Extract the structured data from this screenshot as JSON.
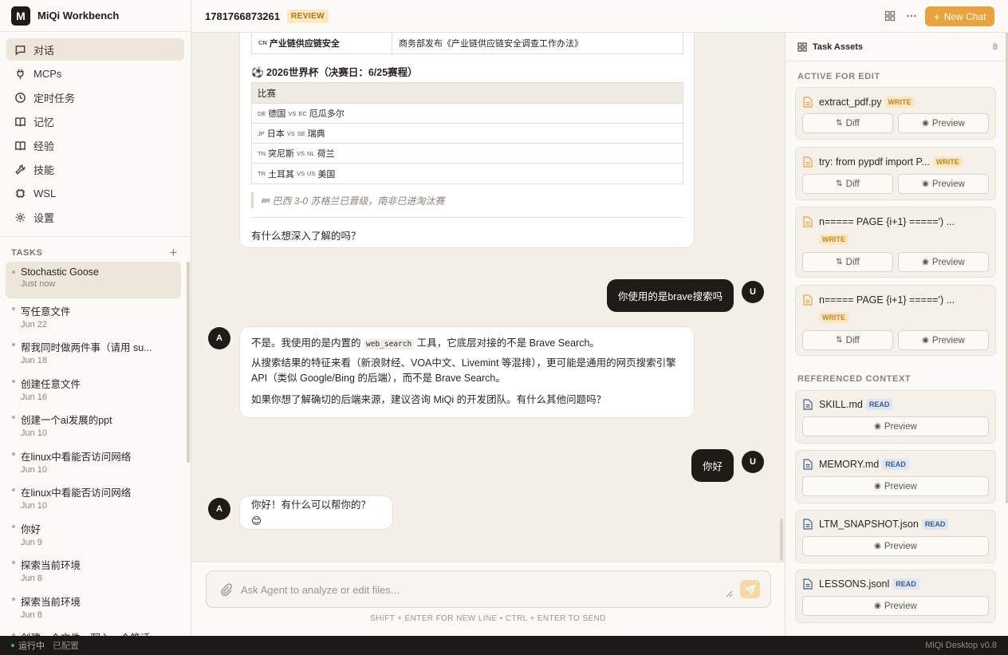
{
  "app": {
    "name": "MiQi Workbench",
    "logo_letter": "M"
  },
  "nav": [
    {
      "label": "对话",
      "icon": "chat-icon",
      "active": true
    },
    {
      "label": "MCPs",
      "icon": "plug-icon"
    },
    {
      "label": "定时任务",
      "icon": "clock-icon"
    },
    {
      "label": "记忆",
      "icon": "book-icon"
    },
    {
      "label": "经验",
      "icon": "book-open-icon"
    },
    {
      "label": "技能",
      "icon": "wrench-icon"
    },
    {
      "label": "WSL",
      "icon": "chip-icon"
    },
    {
      "label": "设置",
      "icon": "gear-icon"
    }
  ],
  "tasks": {
    "heading": "TASKS",
    "add_label": "+",
    "items": [
      {
        "title": "Stochastic Goose",
        "date": "Just now",
        "active": true
      },
      {
        "title": "写任意文件",
        "date": "Jun 22"
      },
      {
        "title": "帮我同时做两件事（请用 su...",
        "date": "Jun 18"
      },
      {
        "title": "创建任意文件",
        "date": "Jun 16"
      },
      {
        "title": "创建一个ai发展的ppt",
        "date": "Jun 10"
      },
      {
        "title": "在linux中看能否访问网络",
        "date": "Jun 10"
      },
      {
        "title": "在linux中看能否访问网络",
        "date": "Jun 10"
      },
      {
        "title": "你好",
        "date": "Jun 9"
      },
      {
        "title": "探索当前环境",
        "date": "Jun 8"
      },
      {
        "title": "探索当前环境",
        "date": "Jun 8"
      },
      {
        "title": "创建一个文件，写入一个笑话",
        "date": ""
      }
    ]
  },
  "header": {
    "chat_id": "1781766873261",
    "status": "REVIEW",
    "new_chat_label": "New Chat"
  },
  "chat": {
    "news_row": {
      "flag": "CN",
      "topic": "产业链供应链安全",
      "detail": "商务部发布《产业链供应链安全调查工作办法》"
    },
    "worldcup_title": "⚽ 2026世界杯（决赛日：6/25赛程）",
    "match_header": "比赛",
    "matches": [
      {
        "f1": "DE",
        "t1": "德国",
        "vs": "VS",
        "f2": "EC",
        "t2": "厄瓜多尔"
      },
      {
        "f1": "JP",
        "t1": "日本",
        "vs": "VS",
        "f2": "SE",
        "t2": "瑞典"
      },
      {
        "f1": "TN",
        "t1": "突尼斯",
        "vs": "VS",
        "f2": "NL",
        "t2": "荷兰"
      },
      {
        "f1": "TR",
        "t1": "土耳其",
        "vs": "VS",
        "f2": "US",
        "t2": "美国"
      }
    ],
    "quote_flag": "BR",
    "quote": "巴西 3-0 苏格兰已晋级，南非已进淘汰赛",
    "follow_up": "有什么想深入了解的吗？",
    "user_avatar": "U",
    "agent_avatar": "A",
    "user_msg_1": "你使用的是brave搜索吗",
    "agent_msg_1_pre": "不是。我使用的是内置的",
    "agent_msg_1_code": "web_search",
    "agent_msg_1_post": "工具，它底层对接的不是 Brave Search。",
    "agent_msg_1_p2": "从搜索结果的特征来看（新浪财经、VOA中文、Livemint 等混排），更可能是通用的网页搜索引擎 API（类似 Google/Bing 的后端），而不是 Brave Search。",
    "agent_msg_1_p3": "如果你想了解确切的后端来源，建议咨询 MiQi 的开发团队。有什么其他问题吗？",
    "user_msg_2": "你好",
    "agent_msg_2": "你好！有什么可以帮你的？ 😊"
  },
  "composer": {
    "placeholder": "Ask Agent to analyze or edit files...",
    "hint": "SHIFT + ENTER FOR NEW LINE • CTRL + ENTER TO SEND"
  },
  "assets": {
    "title": "Task Assets",
    "count": "8",
    "active_heading": "ACTIVE FOR EDIT",
    "referenced_heading": "REFERENCED CONTEXT",
    "diff_label": "Diff",
    "preview_label": "Preview",
    "active": [
      {
        "name": "extract_pdf.py",
        "badge": "WRITE"
      },
      {
        "name": "try: from pypdf import P...",
        "badge": "WRITE"
      },
      {
        "name": "n===== PAGE {i+1} =====') ...",
        "badge": "WRITE"
      },
      {
        "name": "n===== PAGE {i+1} =====') ...",
        "badge": "WRITE"
      }
    ],
    "referenced": [
      {
        "name": "SKILL.md",
        "badge": "READ"
      },
      {
        "name": "MEMORY.md",
        "badge": "READ"
      },
      {
        "name": "LTM_SNAPSHOT.json",
        "badge": "READ"
      },
      {
        "name": "LESSONS.jsonl",
        "badge": "READ"
      }
    ]
  },
  "status": {
    "running": "运行中",
    "configured": "已配置",
    "version": "MiQi Desktop v0.8"
  },
  "colors": {
    "accent": "#e8a33c",
    "dark": "#1f1b17",
    "bg": "#f4f0e8"
  }
}
